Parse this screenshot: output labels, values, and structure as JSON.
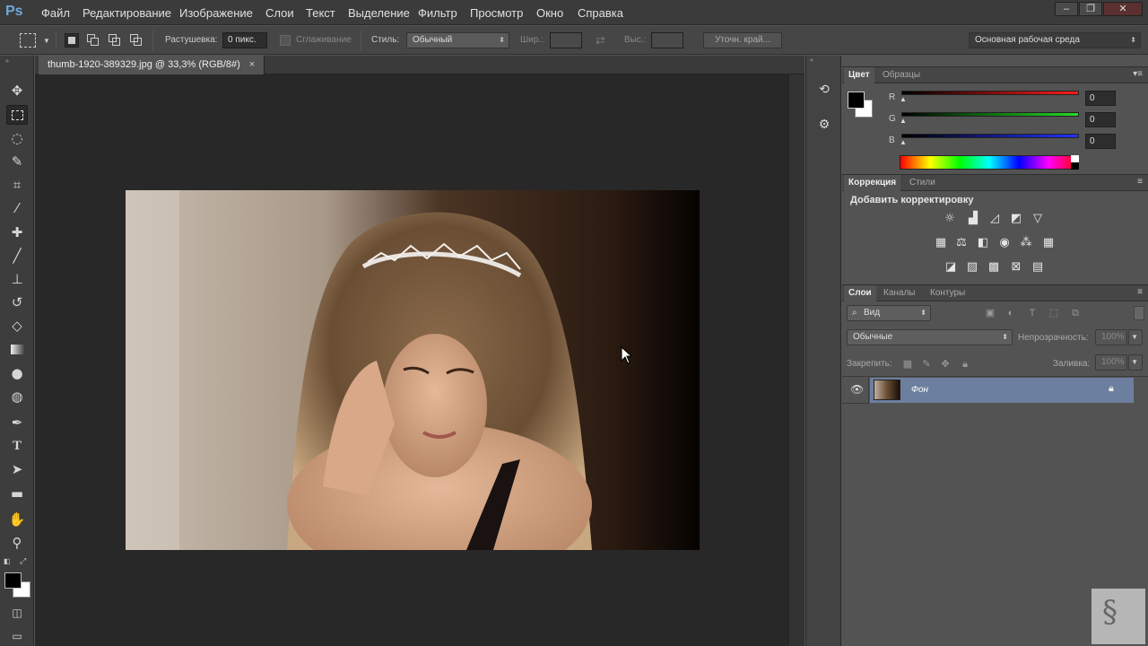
{
  "app": {
    "logo": "Ps",
    "accent": "#6fa8dc"
  },
  "menu": [
    "Файл",
    "Редактирование",
    "Изображение",
    "Слои",
    "Текст",
    "Выделение",
    "Фильтр",
    "Просмотр",
    "Окно",
    "Справка"
  ],
  "options": {
    "feather_label": "Растушевка:",
    "feather_value": "0 пикс.",
    "antialias_label": "Сглаживание",
    "style_label": "Стиль:",
    "style_value": "Обычный",
    "width_label": "Шир.:",
    "height_label": "Выс.:",
    "refine_label": "Уточн. край...",
    "workspace_value": "Основная рабочая среда"
  },
  "document": {
    "tab_title": "thumb-1920-389329.jpg @ 33,3% (RGB/8#)",
    "tab_close": "×"
  },
  "color_panel": {
    "tabs": [
      "Цвет",
      "Образцы"
    ],
    "channels": [
      {
        "label": "R",
        "value": "0",
        "color": "#ff2a2a"
      },
      {
        "label": "G",
        "value": "0",
        "color": "#2ad02a"
      },
      {
        "label": "B",
        "value": "0",
        "color": "#2a3aff"
      }
    ],
    "foreground": "#000000",
    "background": "#ffffff"
  },
  "adjust_panel": {
    "tabs": [
      "Коррекция",
      "Стили"
    ],
    "title": "Добавить корректировку"
  },
  "layers_panel": {
    "tabs": [
      "Слои",
      "Каналы",
      "Контуры"
    ],
    "filter_value": "Вид",
    "blend_value": "Обычные",
    "opacity_label": "Непрозрачность:",
    "opacity_value": "100%",
    "lock_label": "Закрепить:",
    "fill_label": "Заливка:",
    "fill_value": "100%",
    "layer_name": "Фон"
  }
}
